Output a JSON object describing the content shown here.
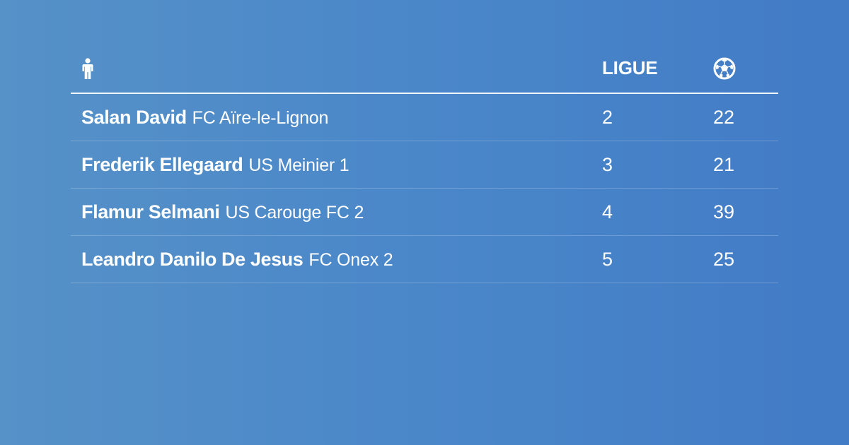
{
  "table": {
    "header": {
      "player_icon": "person-icon",
      "league_label": "LIGUE",
      "goals_icon": "soccer-ball-icon"
    },
    "rows": [
      {
        "player": "Salan David",
        "club": "FC Aïre-le-Lignon",
        "league": "2",
        "goals": "22"
      },
      {
        "player": "Frederik Ellegaard",
        "club": "US Meinier 1",
        "league": "3",
        "goals": "21"
      },
      {
        "player": "Flamur Selmani",
        "club": "US Carouge FC 2",
        "league": "4",
        "goals": "39"
      },
      {
        "player": "Leandro Danilo De Jesus",
        "club": "FC Onex 2",
        "league": "5",
        "goals": "25"
      }
    ]
  },
  "colors": {
    "background_start": "#5691c8",
    "background_end": "#427bc6",
    "text": "#ffffff"
  }
}
